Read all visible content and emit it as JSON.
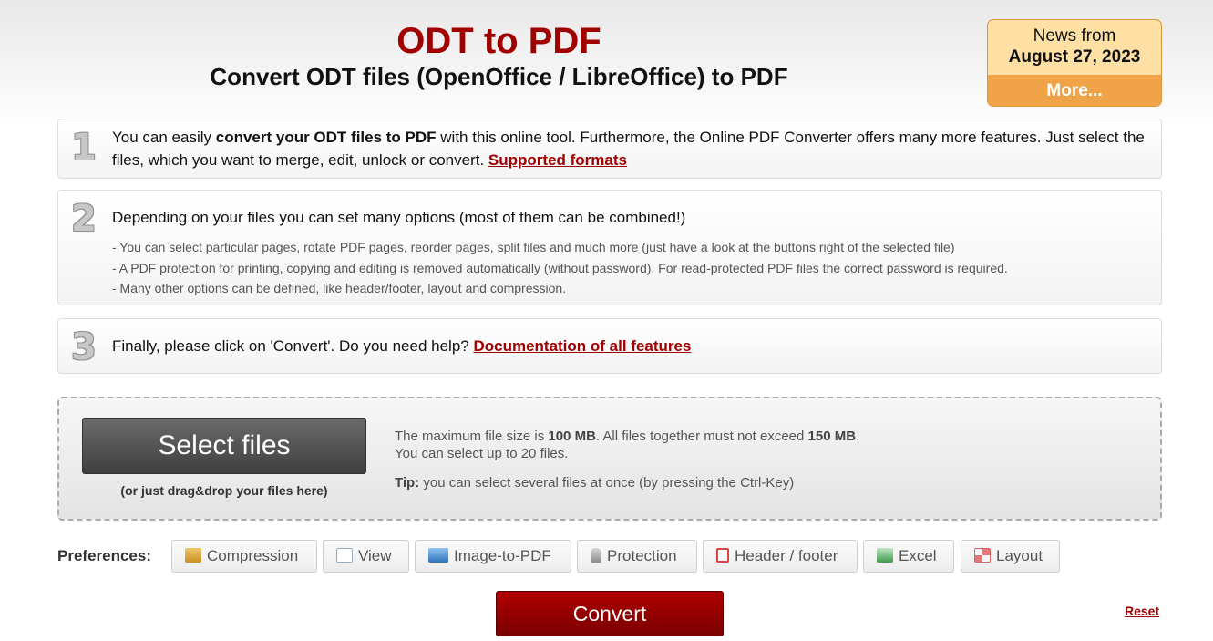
{
  "header": {
    "title": "ODT to PDF",
    "subtitle": "Convert ODT files (OpenOffice / LibreOffice) to PDF"
  },
  "news": {
    "line1": "News from",
    "date": "August 27, 2023",
    "more": "More..."
  },
  "steps": [
    {
      "number": "1",
      "text_a": "You can easily ",
      "text_bold": "convert your ODT files to PDF",
      "text_b": " with this online tool. Furthermore, the Online PDF Converter offers many more features. Just select the files, which you want to merge, edit, unlock or convert. ",
      "link": "Supported formats"
    },
    {
      "number": "2",
      "text": "Depending on your files you can set many options (most of them can be combined!)",
      "bullets": [
        "- You can select particular pages, rotate PDF pages, reorder pages, split files and much more (just have a look at the buttons right of the selected file)",
        "- A PDF protection for printing, copying and editing is removed automatically (without password). For read-protected PDF files the correct password is required.",
        "- Many other options can be defined, like header/footer, layout and compression."
      ]
    },
    {
      "number": "3",
      "text": "Finally, please click on 'Convert'. Do you need help? ",
      "link": "Documentation of all features"
    }
  ],
  "upload": {
    "button": "Select files",
    "drag_hint": "(or just drag&drop your files here)",
    "limit_a": "The maximum file size is ",
    "limit_size": "100 MB",
    "limit_b": ". All files together must not exceed ",
    "limit_total": "150 MB",
    "limit_c": ".",
    "limit_count": "You can select up to 20 files.",
    "tip_label": "Tip:",
    "tip_text": " you can select several files at once (by pressing the Ctrl-Key)"
  },
  "preferences": {
    "label": "Preferences:",
    "buttons": [
      {
        "label": "Compression",
        "icon": "compression-icon",
        "color": "#d9a441"
      },
      {
        "label": "View",
        "icon": "view-icon",
        "color": "#7a9cc6"
      },
      {
        "label": "Image-to-PDF",
        "icon": "image-icon",
        "color": "#4f8fc9"
      },
      {
        "label": "Protection",
        "icon": "lock-icon",
        "color": "#9a9a9a"
      },
      {
        "label": "Header / footer",
        "icon": "header-footer-icon",
        "color": "#d64545"
      },
      {
        "label": "Excel",
        "icon": "excel-icon",
        "color": "#3c9a4a"
      },
      {
        "label": "Layout",
        "icon": "layout-icon",
        "color": "#d06060"
      }
    ]
  },
  "actions": {
    "convert": "Convert",
    "reset": "Reset"
  }
}
